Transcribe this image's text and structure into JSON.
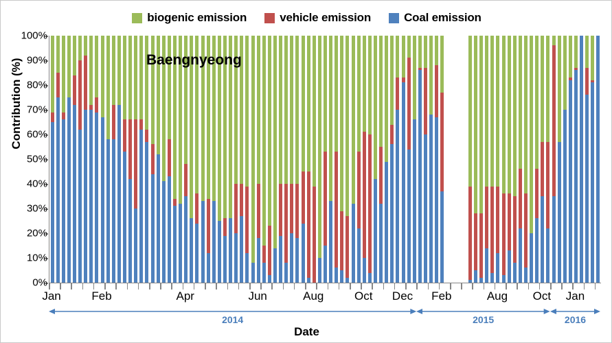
{
  "chart_data": {
    "type": "bar",
    "subtype": "stacked-percentage",
    "title": "Baengnyeong",
    "xlabel": "Date",
    "ylabel": "Contribution (%)",
    "ylim": [
      0,
      100
    ],
    "ytick_labels": [
      "0%",
      "10%",
      "20%",
      "30%",
      "40%",
      "50%",
      "60%",
      "70%",
      "80%",
      "90%",
      "100%"
    ],
    "ytick_values": [
      0,
      10,
      20,
      30,
      40,
      50,
      60,
      70,
      80,
      90,
      100
    ],
    "grid": false,
    "legend_position": "top-center",
    "series": [
      {
        "name": "Coal emission",
        "color": "#4f81bd",
        "stack_order": 1
      },
      {
        "name": "vehicle emission",
        "color": "#c0504d",
        "stack_order": 2
      },
      {
        "name": "biogenic emission",
        "color": "#9bbb59",
        "stack_order": 3
      }
    ],
    "legend_order": [
      "biogenic emission",
      "vehicle emission",
      "Coal emission"
    ],
    "xtick_labels": [
      {
        "label": "Jan",
        "slot": 1
      },
      {
        "label": "Feb",
        "slot": 10
      },
      {
        "label": "Apr",
        "slot": 25
      },
      {
        "label": "Jun",
        "slot": 38
      },
      {
        "label": "Aug",
        "slot": 48
      },
      {
        "label": "Oct",
        "slot": 57
      },
      {
        "label": "Dec",
        "slot": 64
      },
      {
        "label": "Feb",
        "slot": 71
      },
      {
        "label": "Aug",
        "slot": 81
      },
      {
        "label": "Oct",
        "slot": 89
      },
      {
        "label": "Jan",
        "slot": 95
      }
    ],
    "year_brackets": [
      {
        "label": "2014",
        "start_slot": 1,
        "end_slot": 66,
        "arrow": "both"
      },
      {
        "label": "2015",
        "start_slot": 67,
        "end_slot": 90,
        "arrow": "both"
      },
      {
        "label": "2016",
        "start_slot": 91,
        "end_slot": 99,
        "arrow": "both"
      }
    ],
    "total_slots": 99,
    "note": "Values are percent contribution; coal (blue) stacked from 0, vehicle (red) next, biogenic (green) fills to 100%. Empty slots are data gaps.",
    "bars": [
      {
        "slot": 1,
        "coal": 65,
        "vehicle": 4,
        "biogenic": 31
      },
      {
        "slot": 2,
        "coal": 75,
        "vehicle": 10,
        "biogenic": 15
      },
      {
        "slot": 3,
        "coal": 66,
        "vehicle": 3,
        "biogenic": 31
      },
      {
        "slot": 4,
        "coal": 75,
        "vehicle": 0,
        "biogenic": 25
      },
      {
        "slot": 5,
        "coal": 72,
        "vehicle": 12,
        "biogenic": 16
      },
      {
        "slot": 6,
        "coal": 62,
        "vehicle": 28,
        "biogenic": 10
      },
      {
        "slot": 7,
        "coal": 70,
        "vehicle": 22,
        "biogenic": 8
      },
      {
        "slot": 8,
        "coal": 70,
        "vehicle": 2,
        "biogenic": 28
      },
      {
        "slot": 9,
        "coal": 69,
        "vehicle": 6,
        "biogenic": 25
      },
      {
        "slot": 10,
        "coal": 67,
        "vehicle": 0,
        "biogenic": 33
      },
      {
        "slot": 11,
        "coal": 58,
        "vehicle": 0,
        "biogenic": 42
      },
      {
        "slot": 12,
        "coal": 58,
        "vehicle": 14,
        "biogenic": 28
      },
      {
        "slot": 13,
        "coal": 72,
        "vehicle": 0,
        "biogenic": 28
      },
      {
        "slot": 14,
        "coal": 53,
        "vehicle": 13,
        "biogenic": 34
      },
      {
        "slot": 15,
        "coal": 42,
        "vehicle": 24,
        "biogenic": 34
      },
      {
        "slot": 16,
        "coal": 30,
        "vehicle": 36,
        "biogenic": 34
      },
      {
        "slot": 17,
        "coal": 62,
        "vehicle": 4,
        "biogenic": 34
      },
      {
        "slot": 18,
        "coal": 57,
        "vehicle": 5,
        "biogenic": 38
      },
      {
        "slot": 19,
        "coal": 44,
        "vehicle": 12,
        "biogenic": 44
      },
      {
        "slot": 20,
        "coal": 52,
        "vehicle": 0,
        "biogenic": 48
      },
      {
        "slot": 21,
        "coal": 41,
        "vehicle": 0,
        "biogenic": 59
      },
      {
        "slot": 22,
        "coal": 43,
        "vehicle": 15,
        "biogenic": 42
      },
      {
        "slot": 23,
        "coal": 31,
        "vehicle": 3,
        "biogenic": 66
      },
      {
        "slot": 24,
        "coal": 32,
        "vehicle": 0,
        "biogenic": 68
      },
      {
        "slot": 25,
        "coal": 35,
        "vehicle": 13,
        "biogenic": 52
      },
      {
        "slot": 26,
        "coal": 26,
        "vehicle": 0,
        "biogenic": 74
      },
      {
        "slot": 27,
        "coal": 24,
        "vehicle": 12,
        "biogenic": 64
      },
      {
        "slot": 28,
        "coal": 33,
        "vehicle": 0,
        "biogenic": 67
      },
      {
        "slot": 29,
        "coal": 12,
        "vehicle": 22,
        "biogenic": 66
      },
      {
        "slot": 30,
        "coal": 33,
        "vehicle": 0,
        "biogenic": 67
      },
      {
        "slot": 31,
        "coal": 25,
        "vehicle": 0,
        "biogenic": 75
      },
      {
        "slot": 32,
        "coal": 19,
        "vehicle": 7,
        "biogenic": 74
      },
      {
        "slot": 33,
        "coal": 26,
        "vehicle": 0,
        "biogenic": 74
      },
      {
        "slot": 34,
        "coal": 20,
        "vehicle": 20,
        "biogenic": 60
      },
      {
        "slot": 35,
        "coal": 27,
        "vehicle": 13,
        "biogenic": 60
      },
      {
        "slot": 36,
        "coal": 12,
        "vehicle": 27,
        "biogenic": 61
      },
      {
        "slot": 37,
        "coal": 8,
        "vehicle": 0,
        "biogenic": 92
      },
      {
        "slot": 38,
        "coal": 18,
        "vehicle": 22,
        "biogenic": 60
      },
      {
        "slot": 39,
        "coal": 8,
        "vehicle": 7,
        "biogenic": 85
      },
      {
        "slot": 40,
        "coal": 3,
        "vehicle": 20,
        "biogenic": 77
      },
      {
        "slot": 41,
        "coal": 14,
        "vehicle": 0,
        "biogenic": 86
      },
      {
        "slot": 42,
        "coal": 19,
        "vehicle": 21,
        "biogenic": 60
      },
      {
        "slot": 43,
        "coal": 8,
        "vehicle": 32,
        "biogenic": 60
      },
      {
        "slot": 44,
        "coal": 20,
        "vehicle": 20,
        "biogenic": 60
      },
      {
        "slot": 45,
        "coal": 18,
        "vehicle": 22,
        "biogenic": 60
      },
      {
        "slot": 46,
        "coal": 24,
        "vehicle": 21,
        "biogenic": 55
      },
      {
        "slot": 47,
        "coal": 2,
        "vehicle": 43,
        "biogenic": 55
      },
      {
        "slot": 48,
        "coal": 0,
        "vehicle": 39,
        "biogenic": 61
      },
      {
        "slot": 49,
        "coal": 10,
        "vehicle": 0,
        "biogenic": 90
      },
      {
        "slot": 50,
        "coal": 15,
        "vehicle": 38,
        "biogenic": 47
      },
      {
        "slot": 51,
        "coal": 33,
        "vehicle": 0,
        "biogenic": 67
      },
      {
        "slot": 52,
        "coal": 6,
        "vehicle": 47,
        "biogenic": 47
      },
      {
        "slot": 53,
        "coal": 5,
        "vehicle": 24,
        "biogenic": 71
      },
      {
        "slot": 54,
        "coal": 2,
        "vehicle": 25,
        "biogenic": 73
      },
      {
        "slot": 55,
        "coal": 32,
        "vehicle": 0,
        "biogenic": 68
      },
      {
        "slot": 56,
        "coal": 22,
        "vehicle": 31,
        "biogenic": 47
      },
      {
        "slot": 57,
        "coal": 10,
        "vehicle": 51,
        "biogenic": 39
      },
      {
        "slot": 58,
        "coal": 4,
        "vehicle": 56,
        "biogenic": 40
      },
      {
        "slot": 59,
        "coal": 42,
        "vehicle": 0,
        "biogenic": 58
      },
      {
        "slot": 60,
        "coal": 32,
        "vehicle": 23,
        "biogenic": 45
      },
      {
        "slot": 61,
        "coal": 49,
        "vehicle": 0,
        "biogenic": 51
      },
      {
        "slot": 62,
        "coal": 56,
        "vehicle": 8,
        "biogenic": 36
      },
      {
        "slot": 63,
        "coal": 70,
        "vehicle": 13,
        "biogenic": 17
      },
      {
        "slot": 64,
        "coal": 81,
        "vehicle": 2,
        "biogenic": 17
      },
      {
        "slot": 65,
        "coal": 54,
        "vehicle": 37,
        "biogenic": 9
      },
      {
        "slot": 66,
        "coal": 66,
        "vehicle": 0,
        "biogenic": 34
      },
      {
        "slot": 67,
        "coal": 86,
        "vehicle": 1,
        "biogenic": 13
      },
      {
        "slot": 68,
        "coal": 60,
        "vehicle": 27,
        "biogenic": 13
      },
      {
        "slot": 69,
        "coal": 68,
        "vehicle": 0,
        "biogenic": 32
      },
      {
        "slot": 70,
        "coal": 67,
        "vehicle": 21,
        "biogenic": 12
      },
      {
        "slot": 71,
        "coal": 37,
        "vehicle": 40,
        "biogenic": 23
      },
      {
        "slot": 76,
        "coal": 1,
        "vehicle": 38,
        "biogenic": 61
      },
      {
        "slot": 77,
        "coal": 5,
        "vehicle": 23,
        "biogenic": 72
      },
      {
        "slot": 78,
        "coal": 2,
        "vehicle": 26,
        "biogenic": 72
      },
      {
        "slot": 79,
        "coal": 14,
        "vehicle": 25,
        "biogenic": 61
      },
      {
        "slot": 80,
        "coal": 4,
        "vehicle": 35,
        "biogenic": 61
      },
      {
        "slot": 81,
        "coal": 12,
        "vehicle": 27,
        "biogenic": 61
      },
      {
        "slot": 82,
        "coal": 3,
        "vehicle": 33,
        "biogenic": 64
      },
      {
        "slot": 83,
        "coal": 13,
        "vehicle": 23,
        "biogenic": 64
      },
      {
        "slot": 84,
        "coal": 8,
        "vehicle": 27,
        "biogenic": 65
      },
      {
        "slot": 85,
        "coal": 22,
        "vehicle": 24,
        "biogenic": 54
      },
      {
        "slot": 86,
        "coal": 6,
        "vehicle": 30,
        "biogenic": 64
      },
      {
        "slot": 87,
        "coal": 20,
        "vehicle": 0,
        "biogenic": 80
      },
      {
        "slot": 88,
        "coal": 26,
        "vehicle": 20,
        "biogenic": 54
      },
      {
        "slot": 89,
        "coal": 35,
        "vehicle": 22,
        "biogenic": 43
      },
      {
        "slot": 90,
        "coal": 22,
        "vehicle": 35,
        "biogenic": 43
      },
      {
        "slot": 91,
        "coal": 35,
        "vehicle": 61,
        "biogenic": 4
      },
      {
        "slot": 92,
        "coal": 57,
        "vehicle": 0,
        "biogenic": 43
      },
      {
        "slot": 93,
        "coal": 70,
        "vehicle": 0,
        "biogenic": 30
      },
      {
        "slot": 94,
        "coal": 82,
        "vehicle": 1,
        "biogenic": 17
      },
      {
        "slot": 95,
        "coal": 86,
        "vehicle": 1,
        "biogenic": 13
      },
      {
        "slot": 96,
        "coal": 100,
        "vehicle": 0,
        "biogenic": 0
      },
      {
        "slot": 97,
        "coal": 76,
        "vehicle": 11,
        "biogenic": 13
      },
      {
        "slot": 98,
        "coal": 81,
        "vehicle": 1,
        "biogenic": 18
      },
      {
        "slot": 99,
        "coal": 100,
        "vehicle": 0,
        "biogenic": 0
      }
    ]
  }
}
